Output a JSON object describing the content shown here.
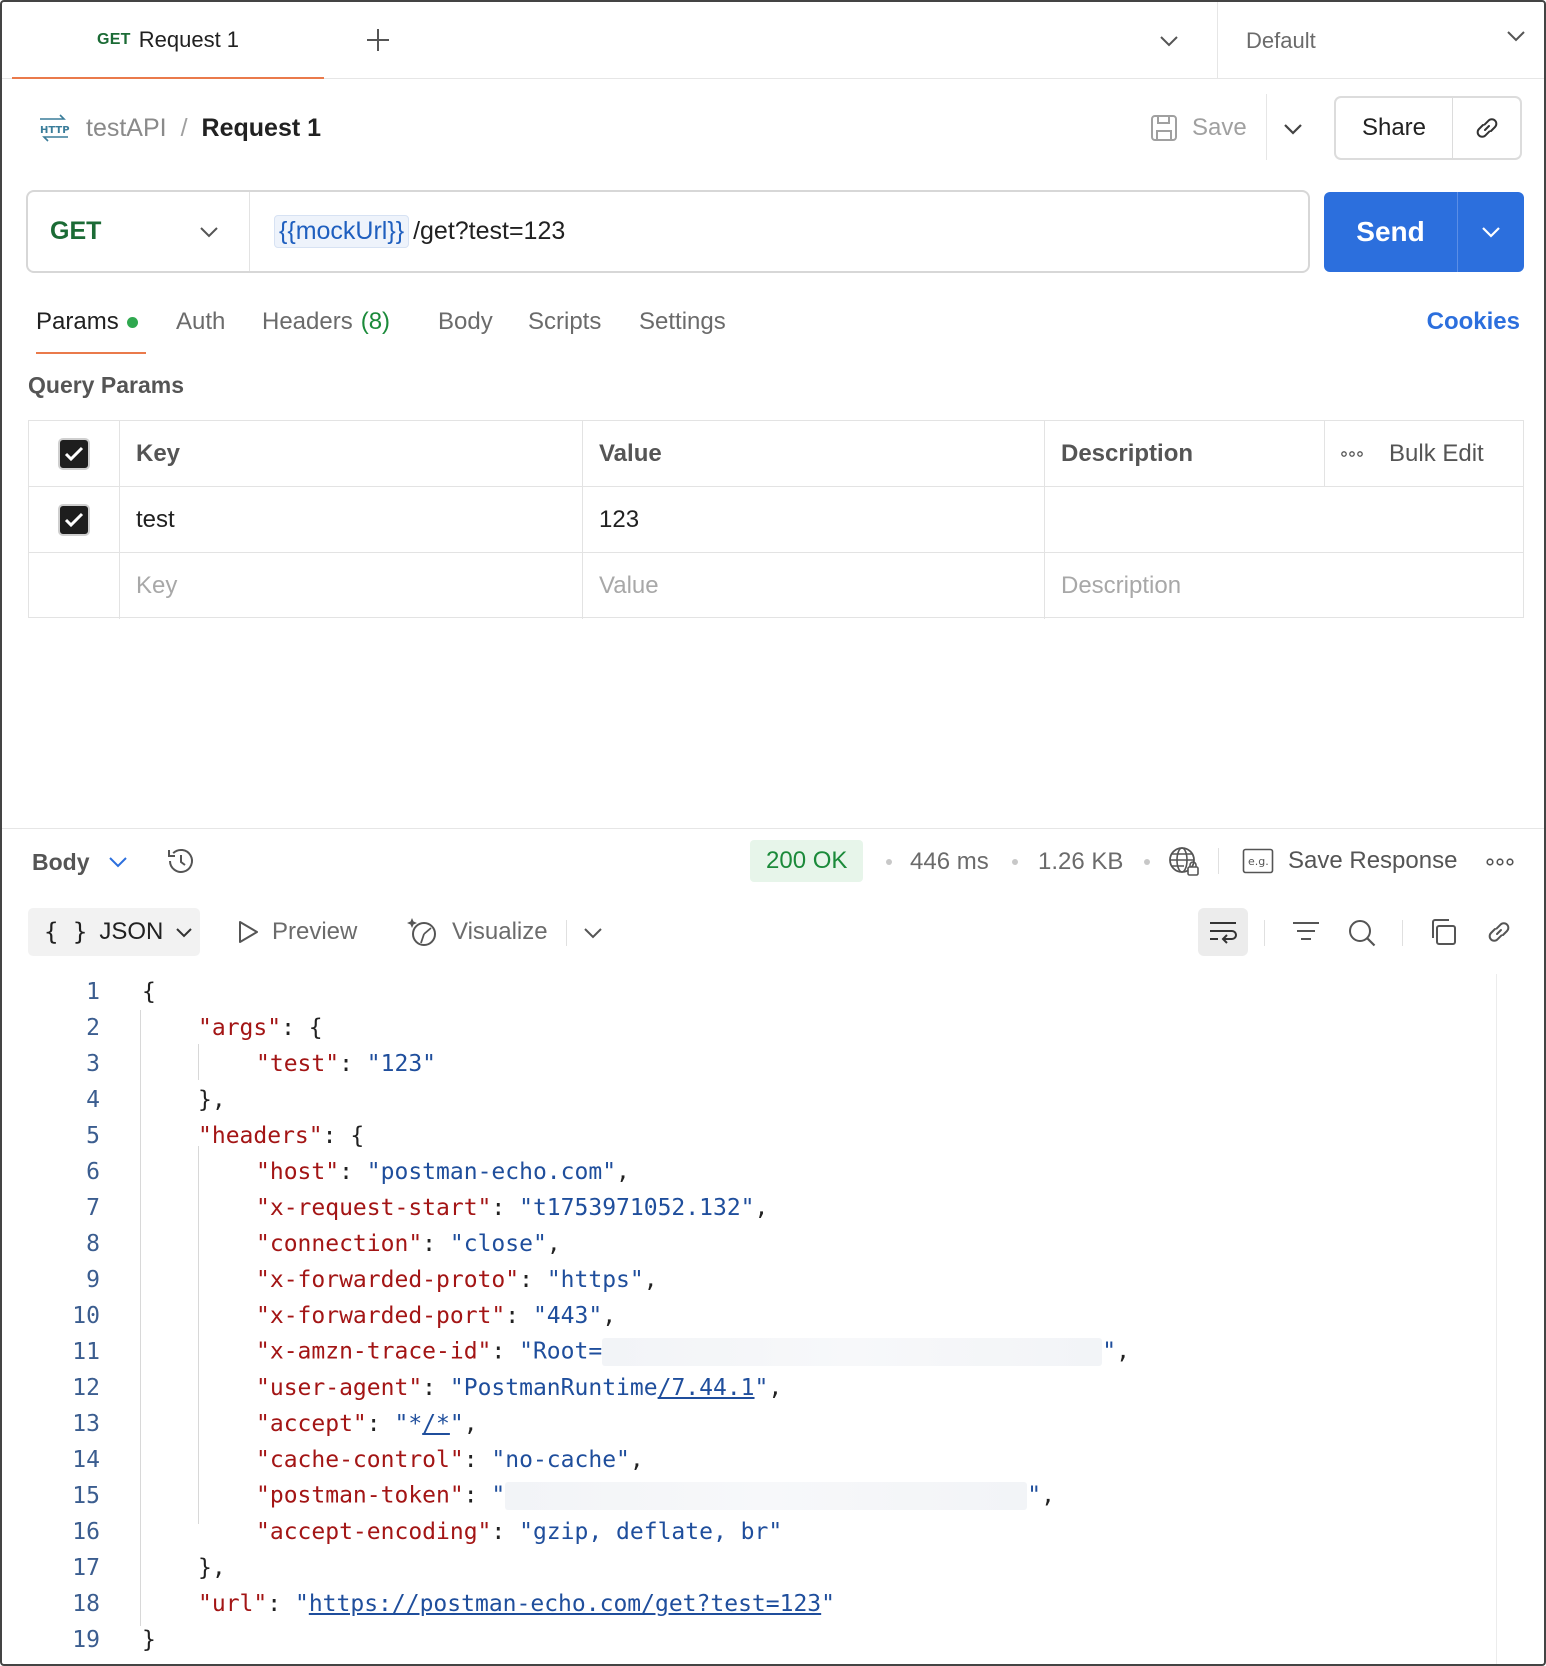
{
  "tab": {
    "method": "GET",
    "title": "Request 1"
  },
  "environment": {
    "selected": "Default"
  },
  "breadcrumb": {
    "icon_text": "HTTP",
    "collection": "testAPI",
    "separator": "/",
    "request": "Request 1"
  },
  "actions": {
    "save_label": "Save",
    "share_label": "Share"
  },
  "url_bar": {
    "method": "GET",
    "variable": "{{mockUrl}}",
    "path": "/get?test=123",
    "send_label": "Send"
  },
  "request_tabs": [
    {
      "label": "Params",
      "active": true,
      "indicator": "dot"
    },
    {
      "label": "Auth"
    },
    {
      "label": "Headers",
      "count": "(8)"
    },
    {
      "label": "Body"
    },
    {
      "label": "Scripts"
    },
    {
      "label": "Settings"
    }
  ],
  "cookies_label": "Cookies",
  "query_params": {
    "title": "Query Params",
    "headers": {
      "key": "Key",
      "value": "Value",
      "description": "Description",
      "bulk_edit": "Bulk Edit"
    },
    "rows": [
      {
        "checked": true,
        "key": "test",
        "value": "123",
        "description": ""
      }
    ],
    "placeholders": {
      "key": "Key",
      "value": "Value",
      "description": "Description"
    }
  },
  "response": {
    "section_label": "Body",
    "status": "200 OK",
    "time": "446 ms",
    "size": "1.26 KB",
    "save_response": "Save Response",
    "format": "JSON",
    "preview_label": "Preview",
    "visualize_label": "Visualize",
    "code_lines": [
      {
        "n": "1",
        "t": "{"
      },
      {
        "n": "2",
        "t": "\"args\": {"
      },
      {
        "n": "3",
        "t": "\"test\": \"123\""
      },
      {
        "n": "4",
        "t": "},"
      },
      {
        "n": "5",
        "t": "\"headers\": {"
      },
      {
        "n": "6",
        "t": "\"host\": \"postman-echo.com\","
      },
      {
        "n": "7",
        "t": "\"x-request-start\": \"t1753971052.132\","
      },
      {
        "n": "8",
        "t": "\"connection\": \"close\","
      },
      {
        "n": "9",
        "t": "\"x-forwarded-proto\": \"https\","
      },
      {
        "n": "10",
        "t": "\"x-forwarded-port\": \"443\","
      },
      {
        "n": "11",
        "t": "\"x-amzn-trace-id\": \"Root=\","
      },
      {
        "n": "12",
        "t": "\"user-agent\": \"PostmanRuntime/7.44.1\","
      },
      {
        "n": "13",
        "t": "\"accept\": \"*/*\","
      },
      {
        "n": "14",
        "t": "\"cache-control\": \"no-cache\","
      },
      {
        "n": "15",
        "t": "\"postman-token\": \"\","
      },
      {
        "n": "16",
        "t": "\"accept-encoding\": \"gzip, deflate, br\""
      },
      {
        "n": "17",
        "t": "},"
      },
      {
        "n": "18",
        "t": "\"url\": \"https://postman-echo.com/get?test=123\""
      },
      {
        "n": "19",
        "t": "}"
      }
    ],
    "code_parts": {
      "l2k": "\"args\"",
      "l3k": "\"test\"",
      "l3v": "\"123\"",
      "l5k": "\"headers\"",
      "l6k": "\"host\"",
      "l6v": "\"postman-echo.com\"",
      "l7k": "\"x-request-start\"",
      "l7v": "\"t1753971052.132\"",
      "l8k": "\"connection\"",
      "l8v": "\"close\"",
      "l9k": "\"x-forwarded-proto\"",
      "l9v": "\"https\"",
      "l10k": "\"x-forwarded-port\"",
      "l10v": "\"443\"",
      "l11k": "\"x-amzn-trace-id\"",
      "l11v": "\"Root=",
      "l12k": "\"user-agent\"",
      "l12v1": "\"PostmanRuntime",
      "l12v2": "/7.44.1",
      "l12v3": "\"",
      "l13k": "\"accept\"",
      "l13v1": "\"*",
      "l13v2": "/*",
      "l13v3": "\"",
      "l14k": "\"cache-control\"",
      "l14v": "\"no-cache\"",
      "l15k": "\"postman-token\"",
      "l15v": "\"",
      "l16k": "\"accept-encoding\"",
      "l16v": "\"gzip, deflate, br\"",
      "l18k": "\"url\"",
      "l18v": "https://postman-echo.com/get?test=123"
    }
  }
}
